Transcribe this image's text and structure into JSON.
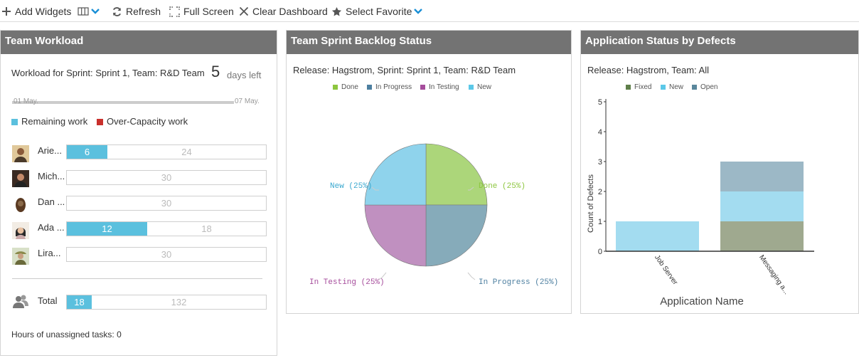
{
  "toolbar": {
    "add_widgets": "Add Widgets",
    "refresh": "Refresh",
    "full_screen": "Full Screen",
    "clear_dashboard": "Clear Dashboard",
    "select_favorite": "Select Favorite"
  },
  "workload": {
    "title": "Team Workload",
    "subtitle": "Workload for Sprint: Sprint 1, Team: R&D Team",
    "days_left_value": "5",
    "days_left_label": "days left",
    "date_start": "01 May.",
    "date_end": "07 May.",
    "legend_remaining": "Remaining work",
    "legend_over": "Over-Capacity work",
    "members": [
      {
        "name": "Arie...",
        "remaining": "6",
        "capacity": "24",
        "fill_fraction": 0.2
      },
      {
        "name": "Mich...",
        "remaining": "",
        "capacity": "30",
        "fill_fraction": 0
      },
      {
        "name": "Dan ...",
        "remaining": "",
        "capacity": "30",
        "fill_fraction": 0
      },
      {
        "name": "Ada ...",
        "remaining": "12",
        "capacity": "18",
        "fill_fraction": 0.4
      },
      {
        "name": "Lira...",
        "remaining": "",
        "capacity": "30",
        "fill_fraction": 0
      }
    ],
    "total_label": "Total",
    "total_remaining": "18",
    "total_capacity": "132",
    "total_fill_fraction": 0.12,
    "unassigned": "Hours of unassigned tasks: 0",
    "colors": {
      "remaining": "#5bc0de",
      "over": "#c9302c"
    }
  },
  "backlog": {
    "title": "Team Sprint Backlog Status",
    "subtitle": "Release: Hagstrom, Sprint: Sprint 1, Team: R&D Team",
    "legend": [
      {
        "label": "Done",
        "color": "#8dc63f"
      },
      {
        "label": "In Progress",
        "color": "#4d7fa0"
      },
      {
        "label": "In Testing",
        "color": "#a64d9c"
      },
      {
        "label": "New",
        "color": "#5bc8e8"
      }
    ],
    "slice_labels": {
      "done": "Done (25%)",
      "in_progress": "In Progress (25%)",
      "in_testing": "In Testing (25%)",
      "new": "New (25%)"
    },
    "chart_data": {
      "type": "pie",
      "categories": [
        "Done",
        "In Progress",
        "In Testing",
        "New"
      ],
      "values": [
        25,
        25,
        25,
        25
      ],
      "colors": [
        "#acd67a",
        "#86abba",
        "#c090c0",
        "#8fd3ec"
      ],
      "legend_placement": "top"
    }
  },
  "defects": {
    "title": "Application Status by Defects",
    "subtitle": "Release: Hagstrom, Team: All",
    "legend": [
      {
        "label": "Fixed",
        "color": "#5f7f4a"
      },
      {
        "label": "New",
        "color": "#5bc8e8"
      },
      {
        "label": "Open",
        "color": "#5a879c"
      }
    ],
    "chart_data": {
      "type": "bar",
      "stacked": true,
      "categories": [
        "Job Server",
        "Messaging a..."
      ],
      "series": [
        {
          "name": "Fixed",
          "values": [
            0,
            1
          ],
          "color": "#9fa98f"
        },
        {
          "name": "New",
          "values": [
            1,
            1
          ],
          "color": "#a3dcf0"
        },
        {
          "name": "Open",
          "values": [
            0,
            1
          ],
          "color": "#9cb8c6"
        }
      ],
      "ylabel": "Count of Defects",
      "xlabel": "Application Name",
      "ylim": [
        0,
        5
      ],
      "yticks": [
        "0",
        "1",
        "2",
        "3",
        "4",
        "5"
      ],
      "grid": false,
      "legend_placement": "top"
    }
  }
}
